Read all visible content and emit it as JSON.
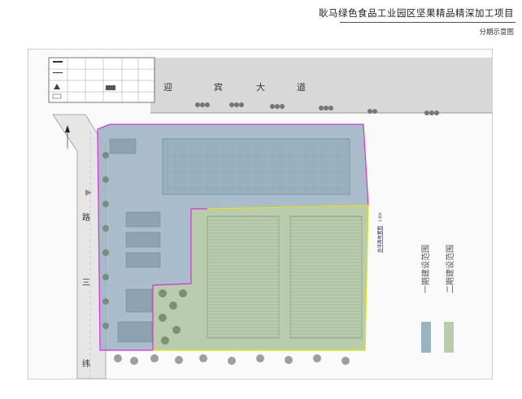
{
  "header": {
    "title": "耿马绿色食品工业园区坚果精品精深加工项目",
    "subtitle": "分期示意图"
  },
  "roads": {
    "top_road_chars": [
      "迎",
      "宾",
      "大",
      "道"
    ],
    "left_road_chars": [
      "路",
      "三",
      "纬"
    ]
  },
  "plan_title": "总平面布置图",
  "plan_scale": "1:300",
  "legend": {
    "phase1_label": "一期建设范围",
    "phase2_label": "二期建设范围",
    "phase1_color": "#9ab3c1",
    "phase2_color": "#b9ccae"
  },
  "colors": {
    "phase1_boundary": "#d630d6",
    "phase2_boundary": "#e2e22a"
  }
}
